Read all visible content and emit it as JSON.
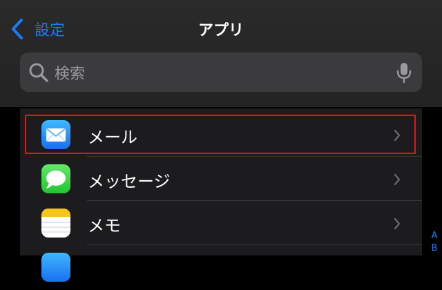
{
  "nav": {
    "back_label": "設定",
    "title": "アプリ"
  },
  "search": {
    "placeholder": "検索"
  },
  "apps": [
    {
      "label": "メール",
      "icon": "mail-icon"
    },
    {
      "label": "メッセージ",
      "icon": "messages-icon"
    },
    {
      "label": "メモ",
      "icon": "notes-icon"
    }
  ],
  "index_letters": [
    "A",
    "B"
  ],
  "colors": {
    "accent": "#1a7cf5",
    "highlight": "#e1141c"
  }
}
